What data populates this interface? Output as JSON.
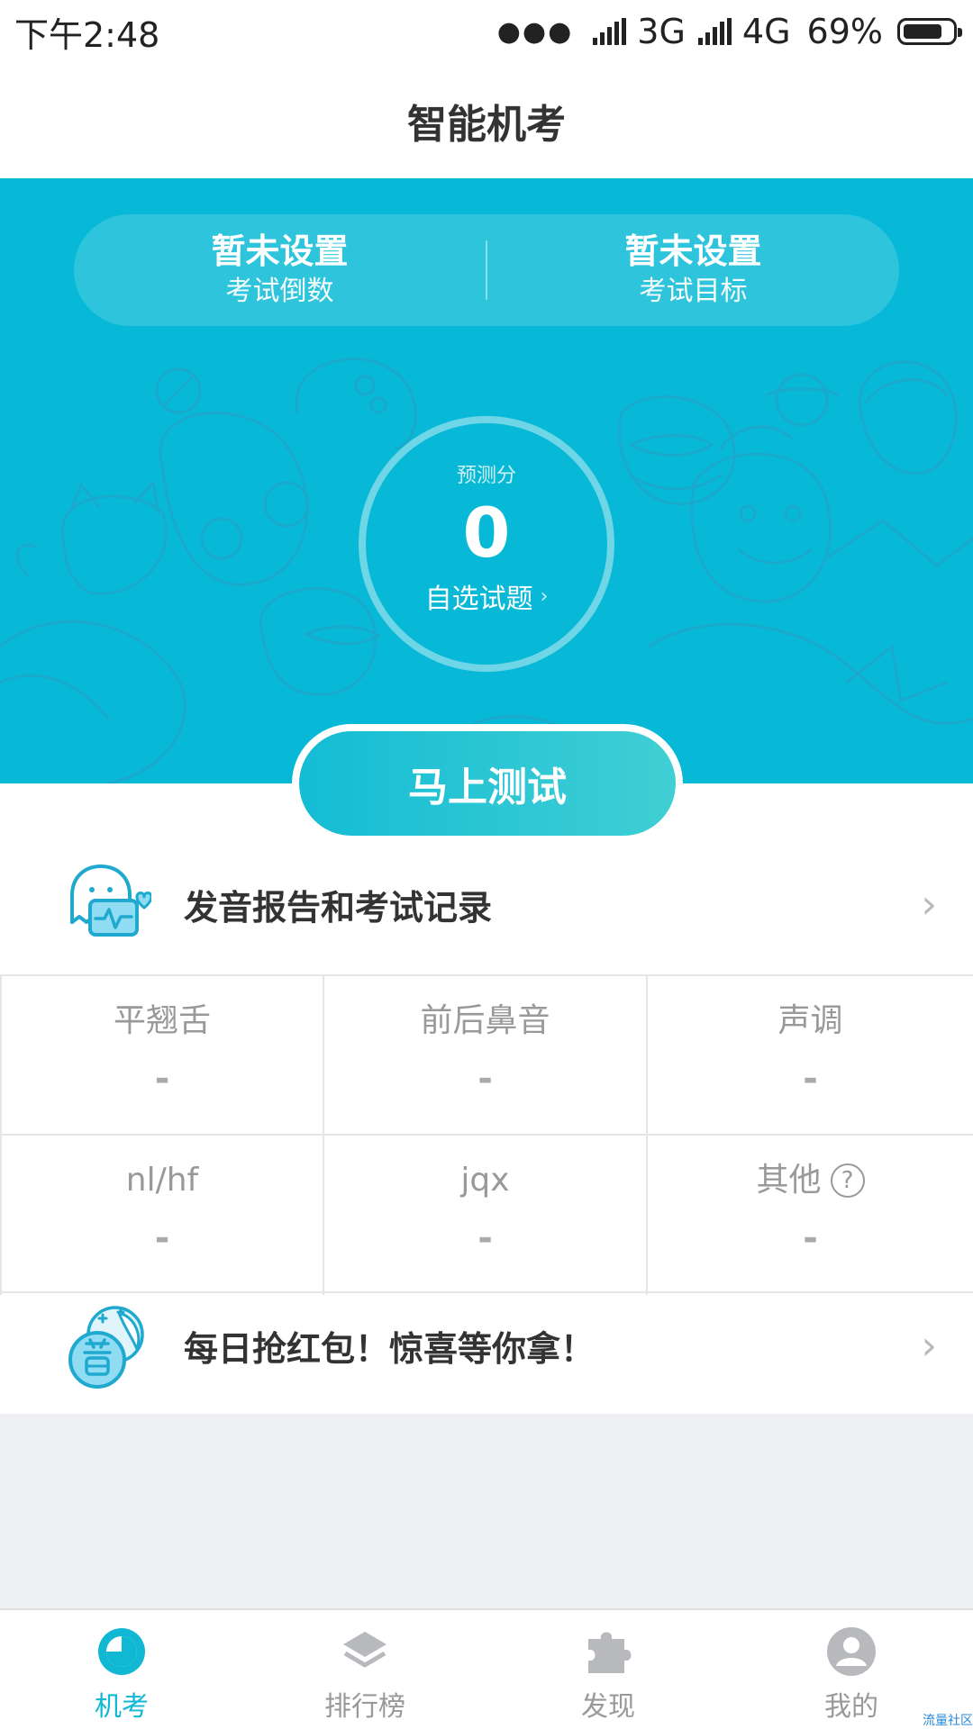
{
  "status_bar": {
    "time": "下午2:48",
    "network1": "3G",
    "network2": "4G",
    "battery": "69%"
  },
  "header": {
    "title": "智能机考"
  },
  "hero": {
    "countdown_value": "暂未设置",
    "countdown_label": "考试倒数",
    "goal_value": "暂未设置",
    "goal_label": "考试目标",
    "score_label": "预测分",
    "score_value": "0",
    "choose_questions": "自选试题",
    "start_button": "马上测试"
  },
  "report": {
    "title": "发音报告和考试记录"
  },
  "stats": [
    {
      "label": "平翘舌",
      "value": "-"
    },
    {
      "label": "前后鼻音",
      "value": "-"
    },
    {
      "label": "声调",
      "value": "-"
    },
    {
      "label": "nl/hf",
      "value": "-"
    },
    {
      "label": "jqx",
      "value": "-"
    },
    {
      "label": "其他",
      "value": "-",
      "help": "?"
    }
  ],
  "promo": {
    "title": "每日抢红包！惊喜等你拿！"
  },
  "tabs": [
    {
      "label": "机考",
      "icon": "clock-icon",
      "active": true
    },
    {
      "label": "排行榜",
      "icon": "layers-icon"
    },
    {
      "label": "发现",
      "icon": "puzzle-icon"
    },
    {
      "label": "我的",
      "icon": "user-icon"
    }
  ],
  "watermark": "流量社区",
  "colors": {
    "accent": "#10b8d3",
    "hero_bg": "#07b9d6",
    "page_bg": "#eef0f4"
  }
}
